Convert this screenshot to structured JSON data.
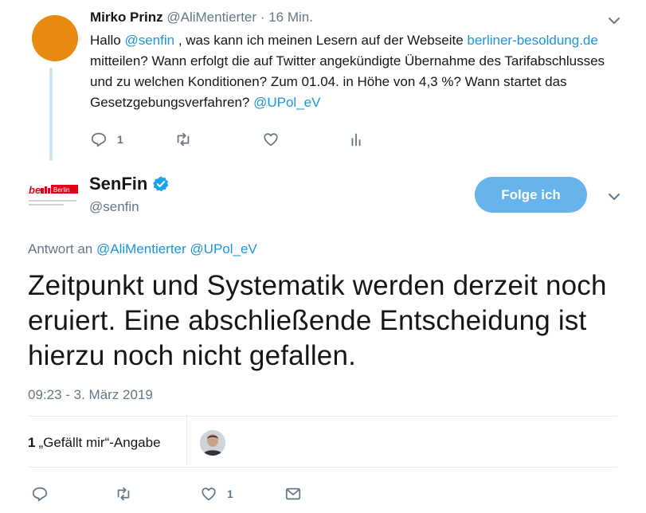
{
  "parent_tweet": {
    "name": "Mirko Prinz",
    "handle": "@AliMentierter",
    "separator": "·",
    "time": "16 Min.",
    "text": {
      "p1": "Hallo ",
      "mention1": "@senfin",
      "p2": " , was kann ich meinen Lesern auf der Webseite ",
      "link": "berliner-besoldung.de",
      "p3": " mitteilen? Wann erfolgt die auf Twitter angekündigte Übernahme des Tarifabschlusses und zu welchen Konditionen? Zum 01.04. in Höhe von 4,3 %? Wann startet das Gesetzgebungsverfahren? ",
      "mention2": "@UPol_eV"
    },
    "reply_count": "1",
    "avatar_color": "#e88a12"
  },
  "main_tweet": {
    "name": "SenFin",
    "handle": "@senfin",
    "follow_label": "Folge ich",
    "reply_prefix": "Antwort an",
    "reply_to_1": "@AliMentierter",
    "reply_to_2": "@UPol_eV",
    "text": "Zeitpunkt und Systematik werden derzeit noch eruiert. Eine abschließende Entscheidung ist hierzu noch nicht gefallen.",
    "timestamp": "09:23 - 3. März 2019",
    "likes_count": "1",
    "likes_label": "„Gefällt mir“-Angabe",
    "like_action_count": "1",
    "logo_text": "be Berlin",
    "logo_subtext": "Senatsverwaltung für Finanzen"
  },
  "colors": {
    "link": "#1b95e0",
    "muted": "#657786",
    "follow_button": "#67b4ec",
    "verified": "#1da1f2",
    "thread_line": "#c9e6fa"
  },
  "icons": [
    "chevron-down-icon",
    "reply-icon",
    "retweet-icon",
    "like-icon",
    "analytics-icon",
    "verified-icon",
    "message-icon"
  ]
}
